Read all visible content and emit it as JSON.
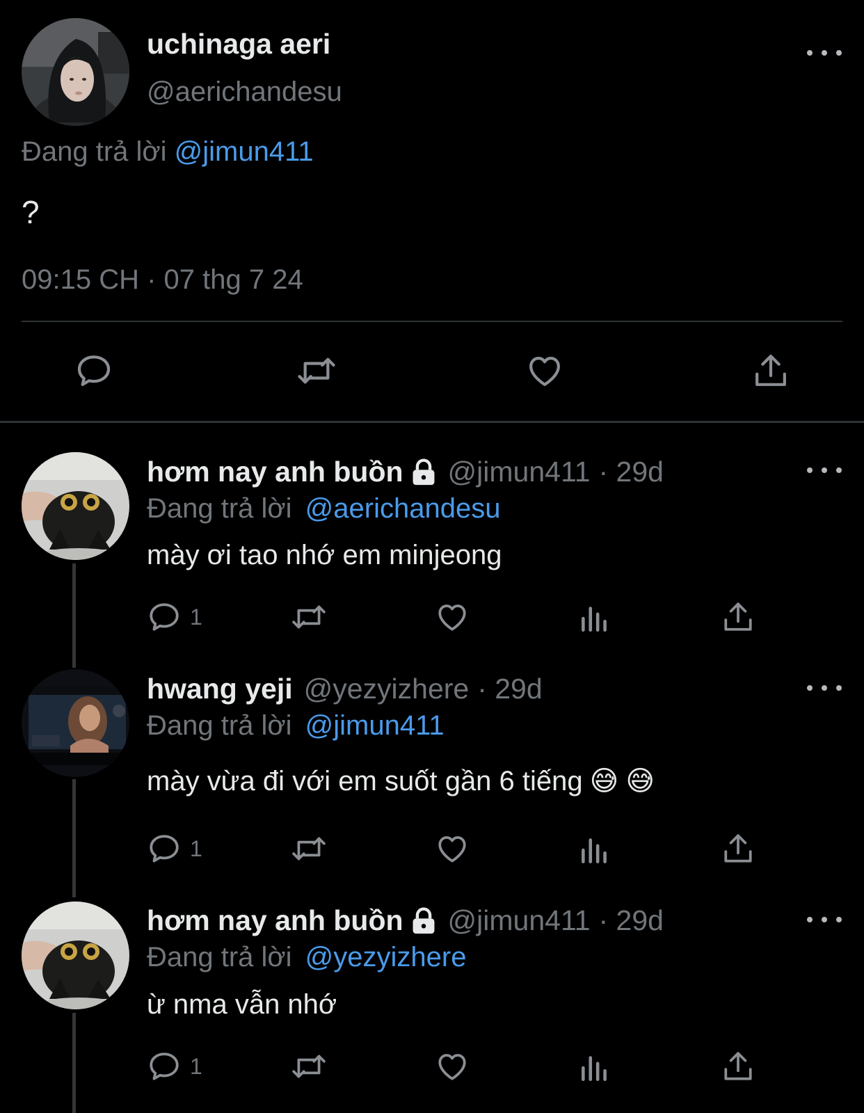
{
  "main_tweet": {
    "display_name": "uchinaga aeri",
    "handle": "@aerichandesu",
    "replying_prefix": "Đang trả lời",
    "replying_to": "@jimun411",
    "text": "?",
    "timestamp": "09:15 CH · 07 thg 7 24",
    "actions": [
      "reply-icon",
      "retweet-icon",
      "like-icon",
      "share-icon"
    ]
  },
  "replies": [
    {
      "display_name": "hơm nay anh buồn",
      "locked": true,
      "handle": "@jimun411",
      "time": "· 29d",
      "replying_prefix": "Đang trả lời",
      "replying_to": "@aerichandesu",
      "text": "mày ơi tao nhớ em minjeong",
      "reply_count": "1"
    },
    {
      "display_name": "hwang yeji",
      "locked": false,
      "handle": "@yezyizhere",
      "time": "· 29d",
      "replying_prefix": "Đang trả lời",
      "replying_to": "@jimun411",
      "text": "mày vừa đi với em suốt gần 6 tiếng",
      "emojis": [
        "😅",
        "😅"
      ],
      "reply_count": "1"
    },
    {
      "display_name": "hơm nay anh buồn",
      "locked": true,
      "handle": "@jimun411",
      "time": "· 29d",
      "replying_prefix": "Đang trả lời",
      "replying_to": "@yezyizhere",
      "text": "ừ nma vẫn nhớ",
      "reply_count": "1"
    }
  ],
  "colors": {
    "background": "#000000",
    "primary_text": "#e7e9ea",
    "secondary_text": "#71767b",
    "mention": "#4a9bea",
    "divider": "#2f3336"
  }
}
